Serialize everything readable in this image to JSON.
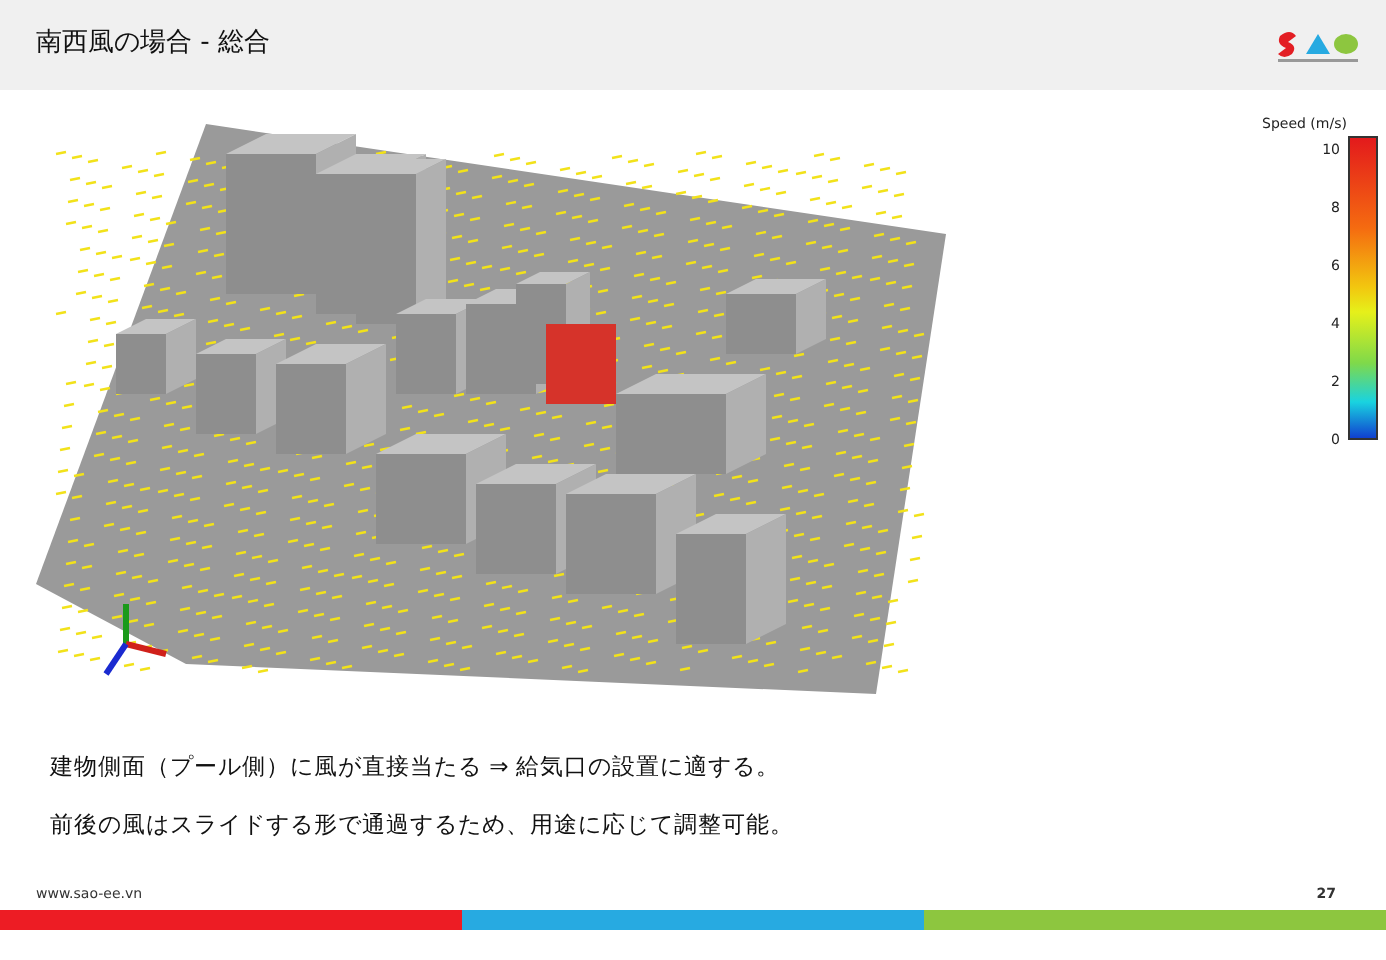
{
  "title": "南西風の場合 - 総合",
  "legend": {
    "title": "Speed (m/s)",
    "ticks": [
      "10",
      "8",
      "6",
      "4",
      "2",
      "0"
    ]
  },
  "notes": [
    "建物側面（プール側）に風が直接当たる ⇒ 給気口の設置に適する。",
    "前後の風はスライドする形で通過するため、用途に応じて調整可能。"
  ],
  "footer": {
    "url": "www.sao-ee.vn",
    "page_number": "27"
  }
}
